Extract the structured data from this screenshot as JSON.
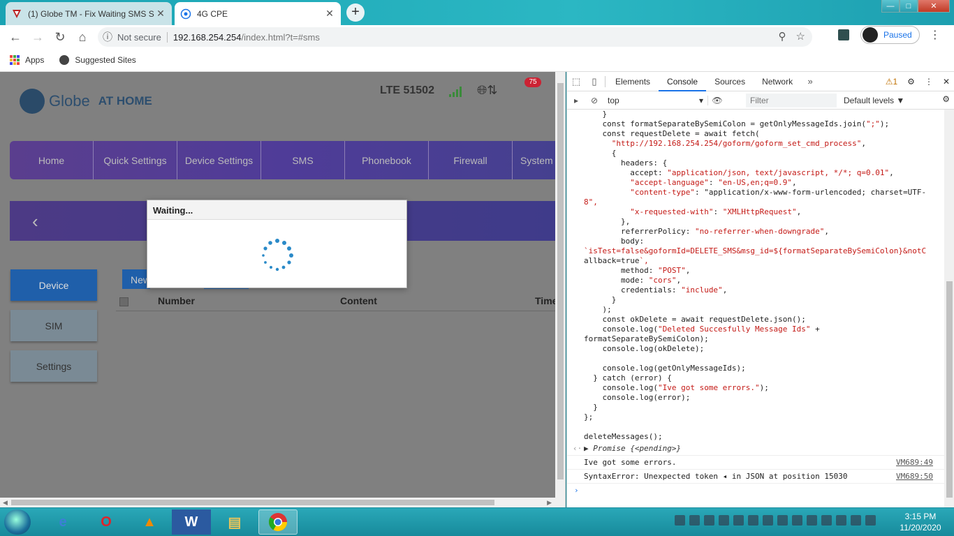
{
  "browser": {
    "tabs": [
      {
        "title": "(1) Globe TM - Fix Waiting SMS S"
      },
      {
        "title": "4G CPE"
      }
    ],
    "new_tab_label": "+",
    "window_controls": {
      "minimize": "—",
      "maximize": "□",
      "close": "✕"
    },
    "address": {
      "security": "Not secure",
      "host": "192.168.254.254",
      "path": "/index.html?t=#sms"
    },
    "profile_status": "Paused",
    "bookmarks": [
      {
        "label": "Apps"
      },
      {
        "label": "Suggested Sites"
      }
    ]
  },
  "router_page": {
    "brand_main": "Globe",
    "brand_sub": "AT HOME",
    "network": "LTE  51502",
    "unread_badge": "75",
    "nav": [
      "Home",
      "Quick Settings",
      "Device Settings",
      "SMS",
      "Phonebook",
      "Firewall",
      "System"
    ],
    "back_glyph": "‹",
    "side": [
      {
        "label": "Device",
        "active": true
      },
      {
        "label": "SIM",
        "active": false
      },
      {
        "label": "Settings",
        "active": false
      }
    ],
    "new_button": "New",
    "table_headers": [
      "Number",
      "Content",
      "Time"
    ],
    "modal": {
      "title": "Waiting..."
    }
  },
  "devtools": {
    "tabs": [
      "Elements",
      "Console",
      "Sources",
      "Network"
    ],
    "selected_tab": "Console",
    "warning_count": "1",
    "context": "top",
    "filter_placeholder": "Filter",
    "levels": "Default levels ▼",
    "code_lines": [
      "    }",
      "    const formatSeparateBySemiColon = getOnlyMessageIds.join(\";\");",
      "    const requestDelete = await fetch(",
      "      \"http://192.168.254.254/goform/goform_set_cmd_process\",",
      "      {",
      "        headers: {",
      "          accept: \"application/json, text/javascript, */*; q=0.01\",",
      "          \"accept-language\": \"en-US,en;q=0.9\",",
      "          \"content-type\": \"application/x-www-form-urlencoded; charset=UTF-",
      "8\",",
      "          \"x-requested-with\": \"XMLHttpRequest\",",
      "        },",
      "        referrerPolicy: \"no-referrer-when-downgrade\",",
      "        body:",
      "`isTest=false&goformId=DELETE_SMS&msg_id=${formatSeparateBySemiColon}&notC",
      "allback=true`,",
      "        method: \"POST\",",
      "        mode: \"cors\",",
      "        credentials: \"include\",",
      "      }",
      "    );",
      "    const okDelete = await requestDelete.json();",
      "    console.log(\"Deleted Succesfully Message Ids\" +",
      "formatSeparateBySemiColon);",
      "    console.log(okDelete);",
      "",
      "    console.log(getOnlyMessageIds);",
      "  } catch (error) {",
      "    console.log(\"Ive got some errors.\");",
      "    console.log(error);",
      "  }",
      "};",
      "",
      "deleteMessages();"
    ],
    "promise_line": "▶ Promise {<pending>}",
    "log_lines": [
      {
        "text": "Ive got some errors.",
        "source": "VM689:49"
      },
      {
        "text": "SyntaxError: Unexpected token ◂ in JSON at position 15030",
        "source": "VM689:50"
      }
    ],
    "prompt": "›"
  },
  "taskbar": {
    "clock_time": "3:15 PM",
    "clock_date": "11/20/2020"
  },
  "colors": {
    "router_nav": "#4f3c98",
    "router_active": "#1f5faa",
    "devtools_accent": "#1a73e8",
    "string_literal": "#c41a16"
  }
}
